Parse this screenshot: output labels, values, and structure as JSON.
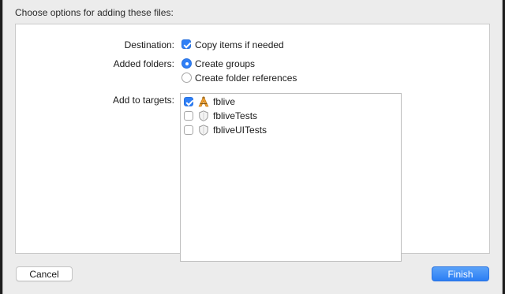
{
  "dialog": {
    "title": "Choose options for adding these files:"
  },
  "destination": {
    "label": "Destination:",
    "option_label": "Copy items if needed",
    "checked": true
  },
  "added_folders": {
    "label": "Added folders:",
    "options": [
      {
        "label": "Create groups",
        "selected": true
      },
      {
        "label": "Create folder references",
        "selected": false
      }
    ]
  },
  "targets": {
    "label": "Add to targets:",
    "items": [
      {
        "name": "fblive",
        "checked": true,
        "icon": "app-target-icon"
      },
      {
        "name": "fbliveTests",
        "checked": false,
        "icon": "test-target-icon"
      },
      {
        "name": "fbliveUITests",
        "checked": false,
        "icon": "test-target-icon"
      }
    ]
  },
  "buttons": {
    "cancel": "Cancel",
    "finish": "Finish"
  },
  "colors": {
    "accent": "#2f7ff6",
    "sheet_background": "#ececec",
    "content_background": "#ffffff"
  }
}
